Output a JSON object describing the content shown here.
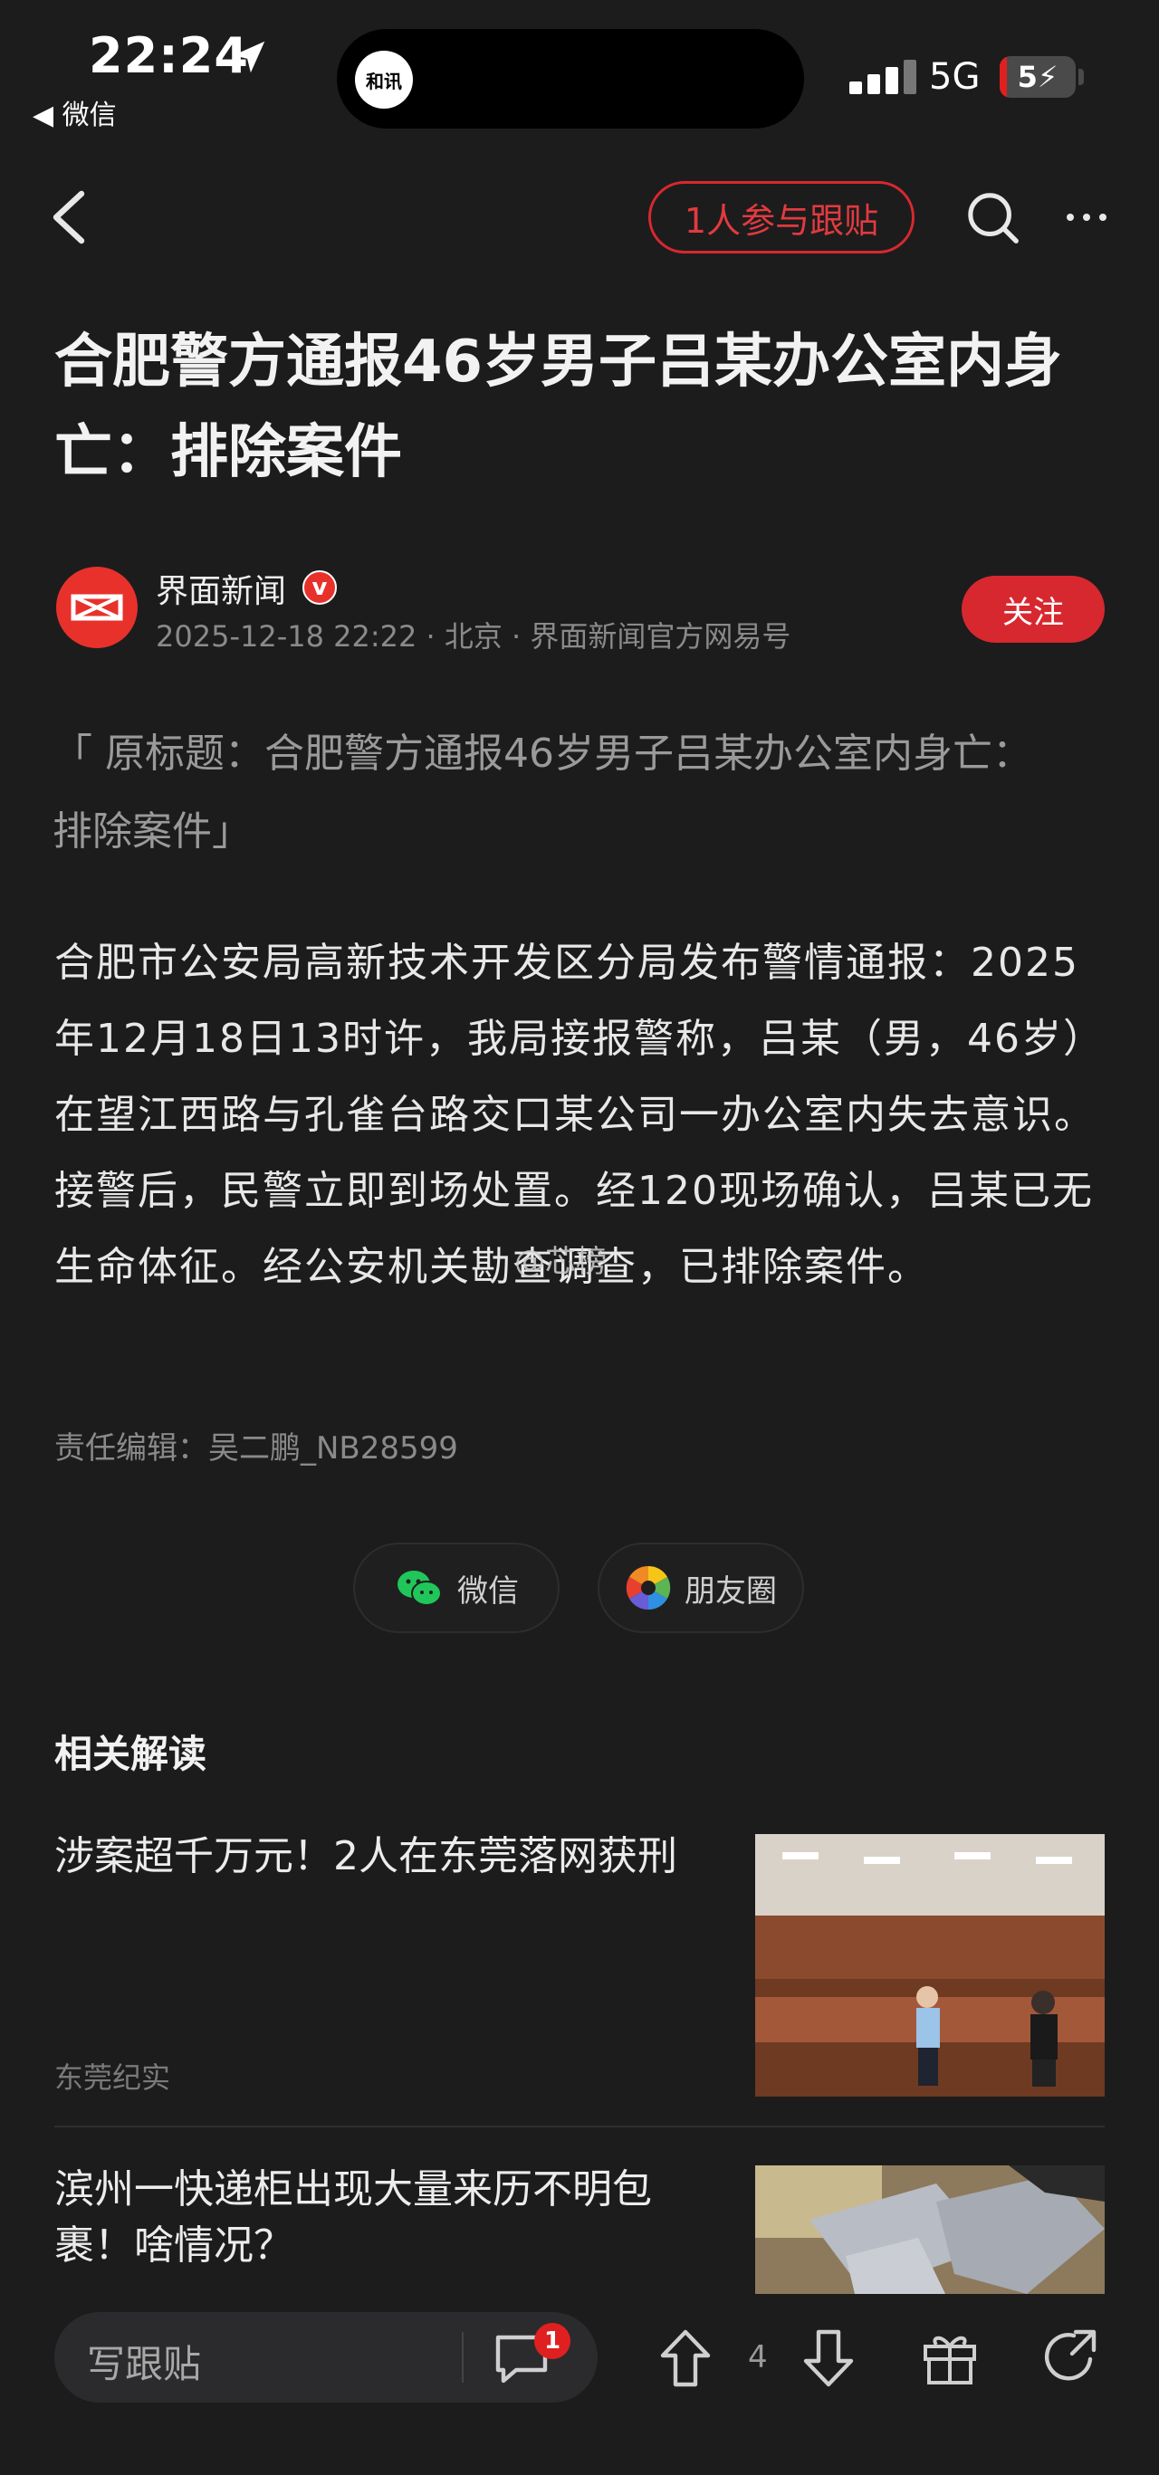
{
  "status_bar": {
    "time": "22:24",
    "back_app": "◀ 微信",
    "island_logo": "和讯",
    "network": "5G",
    "battery": "5"
  },
  "nav": {
    "follow_posts": "1人参与跟贴"
  },
  "article": {
    "title": "合肥警方通报46岁男子吕某办公室内身亡：排除案件",
    "author": "界面新闻",
    "verified_badge": "v",
    "meta": "2025-12-18 22:22 · 北京 · 界面新闻官方网易号",
    "follow_button": "关注",
    "original_title": "「 原标题：合肥警方通报46岁男子吕某办公室内身亡：排除案件」",
    "body": "合肥市公安局高新技术开发区分局发布警情通报：2025年12月18日13时许，我局接报警称，吕某（男，46岁）在望江西路与孔雀台路交口某公司一办公室内失去意识。接警后，民警立即到场处置。经120现场确认，吕某已无生命体征。经公安机关勘查调查，已排除案件。",
    "watermark": "@芯榜",
    "editor": "责任编辑：吴二鹏_NB28599"
  },
  "share": {
    "wechat": "微信",
    "moments": "朋友圈"
  },
  "related": {
    "heading": "相关解读",
    "items": [
      {
        "title": "涉案超千万元！2人在东莞落网获刑",
        "source": "东莞纪实"
      },
      {
        "title": "滨州一快递柜出现大量来历不明包裹！啥情况？",
        "source": ""
      }
    ]
  },
  "bottom_bar": {
    "reply_placeholder": "写跟贴",
    "comment_count": "1",
    "vote_count": "4"
  },
  "colors": {
    "accent": "#d8282f",
    "background": "#1c1c1d"
  }
}
